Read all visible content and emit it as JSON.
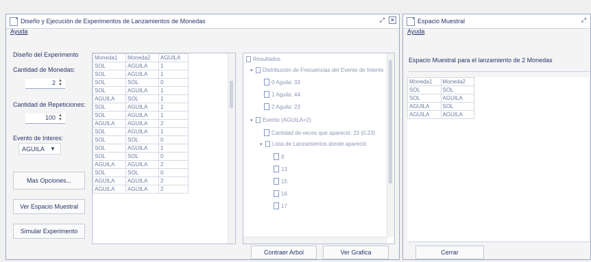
{
  "main_window": {
    "title": "Diseño y Ejecución de Experimentos de Lanzamientos de Monedas",
    "menu": "Ayuda",
    "design_heading": "Diseño del Experimento",
    "coins_label": "Cantidad de Monedas:",
    "coins_value": "2",
    "reps_label": "Cantidad de Repeticiones:",
    "reps_value": "100",
    "event_label": "Evento de Interes:",
    "event_value": "AGUILA",
    "more_options": "Mas Opciones...",
    "view_sample_space": "Ver Espacio Muestral",
    "simulate": "Simular Experimento",
    "table_headers": [
      "Moneda1",
      "Moneda2",
      "AGUILA"
    ],
    "table_rows": [
      [
        "SOL",
        "AGUILA",
        "1"
      ],
      [
        "SOL",
        "AGUILA",
        "1"
      ],
      [
        "SOL",
        "SOL",
        "0"
      ],
      [
        "SOL",
        "AGUILA",
        "1"
      ],
      [
        "AGUILA",
        "SOL",
        "1"
      ],
      [
        "SOL",
        "AGUILA",
        "1"
      ],
      [
        "SOL",
        "AGUILA",
        "1"
      ],
      [
        "AGUILA",
        "AGUILA",
        "2"
      ],
      [
        "SOL",
        "AGUILA",
        "1"
      ],
      [
        "SOL",
        "SOL",
        "0"
      ],
      [
        "SOL",
        "AGUILA",
        "1"
      ],
      [
        "SOL",
        "SOL",
        "0"
      ],
      [
        "AGUILA",
        "AGUILA",
        "2"
      ],
      [
        "SOL",
        "SOL",
        "0"
      ],
      [
        "AGUILA",
        "AGUILA",
        "2"
      ],
      [
        "AGUILA",
        "AGUILA",
        "2"
      ]
    ],
    "tree": {
      "root": "Resultados",
      "dist": "Distribución de Frecuencias del Evento de Interés",
      "agu0": "0 Aguila: 33",
      "agu1": "1 Aguila: 44",
      "agu2": "2 Aguila: 23",
      "event": "Evento (AGUILA=2)",
      "times": "Cantidad de veces que apareció: 23 (0.23)",
      "list": "Lista de Lanzamientos donde apareció",
      "n1": "8",
      "n2": "13",
      "n3": "15",
      "n4": "16",
      "n5": "17"
    },
    "collapse_tree": "Contraer Arbol",
    "view_chart": "Ver Grafica"
  },
  "sample_window": {
    "title": "Espacio Muestral",
    "menu": "Ayuda",
    "heading": "Espacio Muestral para el lanzamiento de 2 Monedas",
    "headers": [
      "Moneda1",
      "Moneda2"
    ],
    "rows": [
      [
        "SOL",
        "SOL"
      ],
      [
        "SOL",
        "AGUILA"
      ],
      [
        "AGUILA",
        "SOL"
      ],
      [
        "AGUILA",
        "AGUILA"
      ]
    ],
    "close": "Cerrar"
  }
}
